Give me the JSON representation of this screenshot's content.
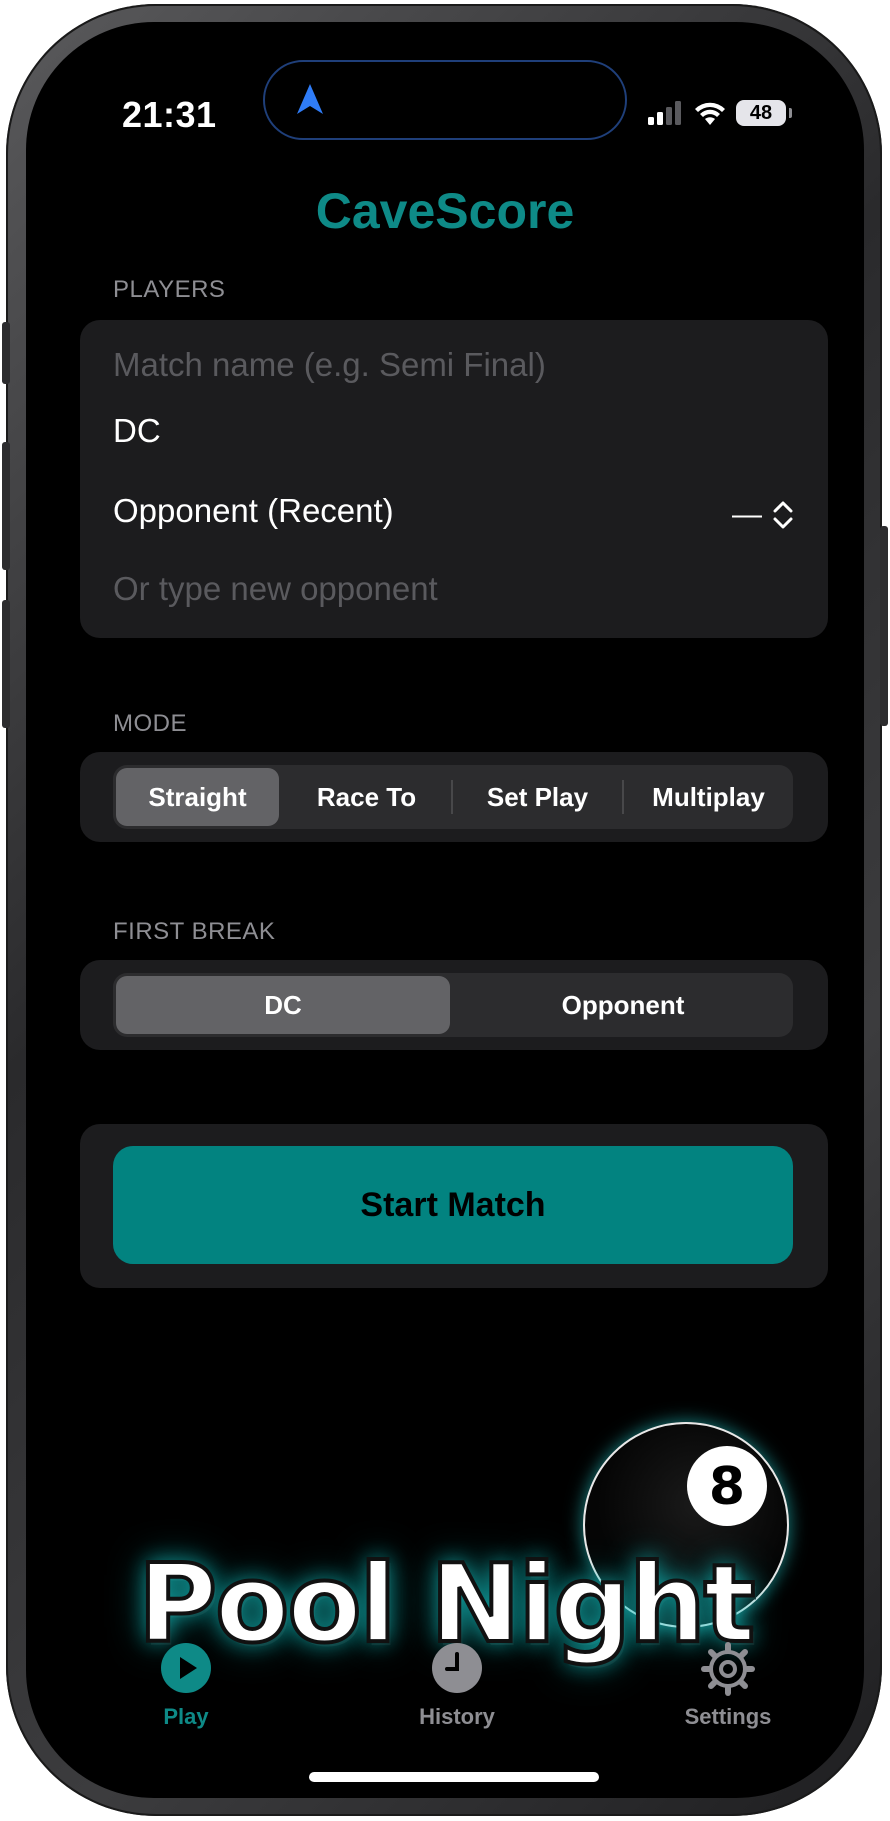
{
  "status_bar": {
    "time": "21:31",
    "battery": "48"
  },
  "app": {
    "title": "CaveScore"
  },
  "players": {
    "header": "PLAYERS",
    "match_name_placeholder": "Match name (e.g. Semi Final)",
    "player_name": "DC",
    "opponent_picker_label": "Opponent (Recent)",
    "opponent_picker_value": "—",
    "new_opponent_placeholder": "Or type new opponent"
  },
  "mode": {
    "header": "MODE",
    "options": [
      "Straight",
      "Race To",
      "Set Play",
      "Multiplay"
    ],
    "selected": "Straight"
  },
  "first_break": {
    "header": "FIRST BREAK",
    "options": [
      "DC",
      "Opponent"
    ],
    "selected": "DC"
  },
  "actions": {
    "start_label": "Start Match"
  },
  "promo": {
    "text": "Pool Night",
    "ball_number": "8"
  },
  "tab_bar": {
    "items": [
      {
        "label": "Play",
        "icon": "play-icon",
        "active": true
      },
      {
        "label": "History",
        "icon": "clock-icon",
        "active": false
      },
      {
        "label": "Settings",
        "icon": "gear-icon",
        "active": false
      }
    ]
  },
  "colors": {
    "accent": "#028380",
    "title": "#0e8a87",
    "card": "#1c1c1e",
    "segment_selected": "#636366"
  }
}
